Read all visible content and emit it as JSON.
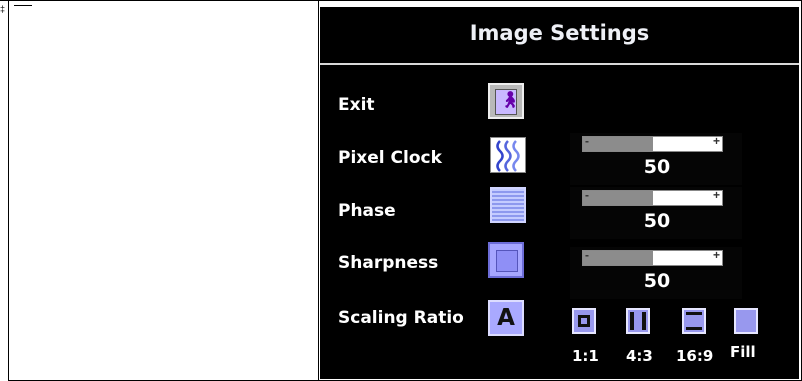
{
  "osd": {
    "title": "Image Settings",
    "items": [
      {
        "label": "Exit",
        "icon": "exit-icon"
      },
      {
        "label": "Pixel Clock",
        "icon": "pixel-clock-icon",
        "value": "50",
        "level": 0.5
      },
      {
        "label": "Phase",
        "icon": "phase-icon",
        "value": "50",
        "level": 0.5
      },
      {
        "label": "Sharpness",
        "icon": "sharpness-icon",
        "value": "50",
        "level": 0.5
      },
      {
        "label": "Scaling Ratio",
        "icon": "scaling-ratio-icon"
      }
    ],
    "ratios": [
      {
        "label": "1:1",
        "icon": "ratio-1-1-icon"
      },
      {
        "label": "4:3",
        "icon": "ratio-4-3-icon"
      },
      {
        "label": "16:9",
        "icon": "ratio-16-9-icon"
      },
      {
        "label": "Fill",
        "icon": "ratio-fill-icon"
      }
    ],
    "slider_minus": "-",
    "slider_plus": "+"
  },
  "colors": {
    "osd_background": "#000000",
    "icon_blue": "#a9a9ff",
    "slider_fill": "#8c8c8c"
  }
}
